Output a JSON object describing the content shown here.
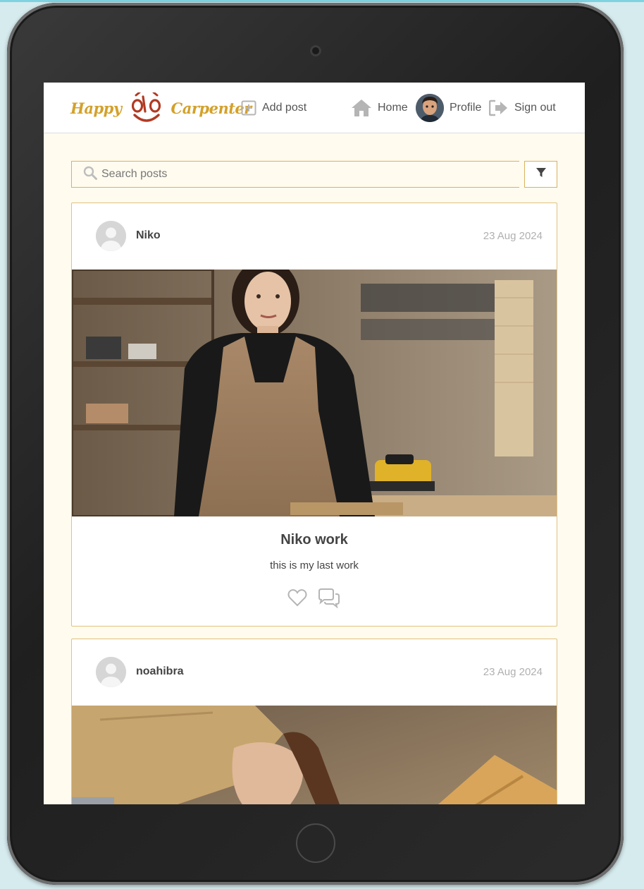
{
  "brand": {
    "word_left": "Happy",
    "word_right": "Carpenter",
    "colors": {
      "gold": "#d3a12b",
      "red": "#b23a22"
    }
  },
  "nav": {
    "add_post": "Add post",
    "home": "Home",
    "profile": "Profile",
    "sign_out": "Sign out"
  },
  "search": {
    "placeholder": "Search posts",
    "value": ""
  },
  "posts": [
    {
      "author": "Niko",
      "date": "23 Aug 2024",
      "title": "Niko work",
      "content": "this is my last work",
      "icons": [
        "heart-icon",
        "comments-icon"
      ]
    },
    {
      "author": "noahibra",
      "date": "23 Aug 2024"
    }
  ],
  "theme": {
    "accent_border": "#d8b25b",
    "page_bg": "#fffbef"
  }
}
